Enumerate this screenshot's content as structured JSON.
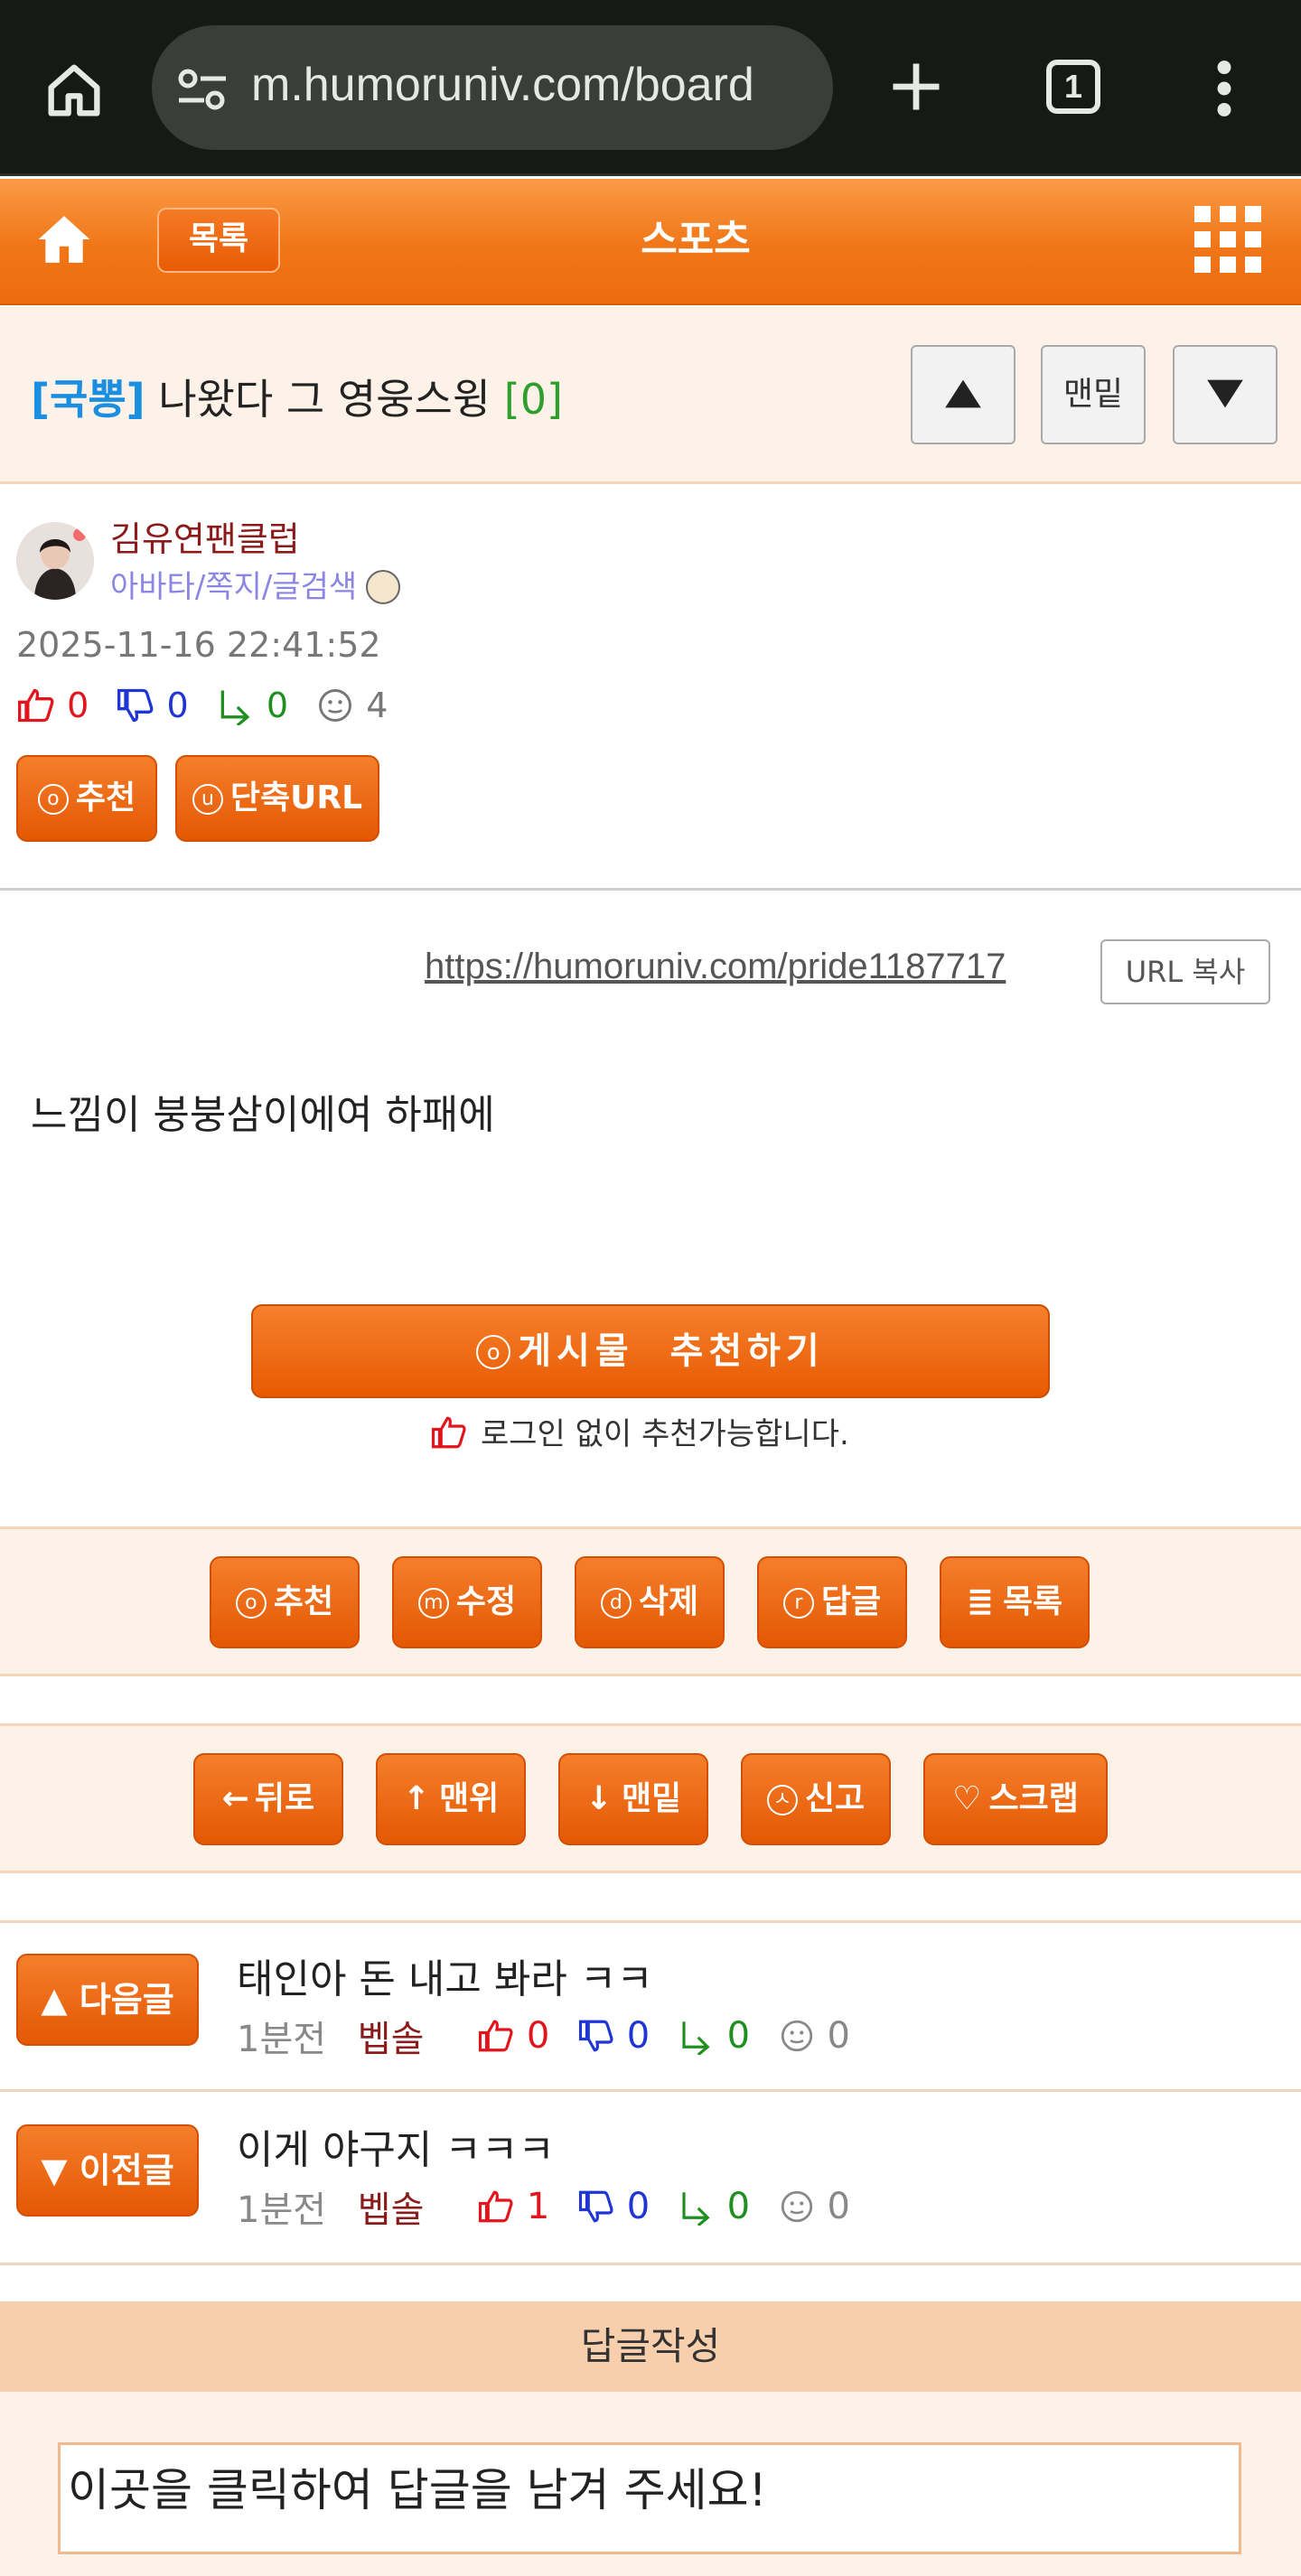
{
  "browser": {
    "url": "m.humoruniv.com/board",
    "tab_count": "1"
  },
  "header": {
    "list_label": "목록",
    "board_title": "스포츠"
  },
  "post": {
    "category": "[국뽕]",
    "title": "나왔다 그 영웅스윙",
    "comment_count": "[0]",
    "nav_bottom_label": "맨밑",
    "author": "김유연팬클럽",
    "author_links": "아바타/쪽지/글검색",
    "date": "2025-11-16 22:41:52",
    "stats": {
      "up": "0",
      "down": "0",
      "reply": "0",
      "views": "4"
    },
    "recommend_label": "추천",
    "recommend_key": "o",
    "short_url_label": "단축URL",
    "short_url_key": "u",
    "url": "https://humoruniv.com/pride1187717",
    "url_copy_label": "URL 복사",
    "content": "느낌이 붕붕삼이에여 하패에",
    "recommend_big_label": "게시물  추천하기",
    "recommend_big_key": "o",
    "login_note": "로그인 없이 추천가능합니다."
  },
  "actions_row1": [
    {
      "key": "o",
      "label": "추천"
    },
    {
      "key": "m",
      "label": "수정"
    },
    {
      "key": "d",
      "label": "삭제"
    },
    {
      "key": "r",
      "label": "답글"
    },
    {
      "key": "≣",
      "label": "목록"
    }
  ],
  "actions_row2": [
    {
      "key": "←",
      "label": "뒤로"
    },
    {
      "key": "↑",
      "label": "맨위"
    },
    {
      "key": "↓",
      "label": "맨밑"
    },
    {
      "key": "ㅅ",
      "label": "신고"
    },
    {
      "key": "♡",
      "label": "스크랩"
    }
  ],
  "next_post": {
    "button": "▲ 다음글",
    "title": "태인아 돈 내고 봐라 ㅋㅋ",
    "time": "1분전",
    "author": "벱솔",
    "up": "0",
    "down": "0",
    "reply": "0",
    "views": "0"
  },
  "prev_post": {
    "button": "▼ 이전글",
    "title": "이게 야구지 ㅋㅋㅋ",
    "time": "1분전",
    "author": "벱솔",
    "up": "1",
    "down": "0",
    "reply": "0",
    "views": "0"
  },
  "reply": {
    "header": "답글작성",
    "placeholder": "이곳을 클릭하여 답글을 남겨 주세요!"
  },
  "colors": {
    "brand_orange": "#ec6c0d",
    "category_blue": "#1a8ee0",
    "author_red": "#8b1b1b",
    "up_red": "#e2141c",
    "down_blue": "#1f35d6",
    "reply_green": "#1f8f1f"
  }
}
